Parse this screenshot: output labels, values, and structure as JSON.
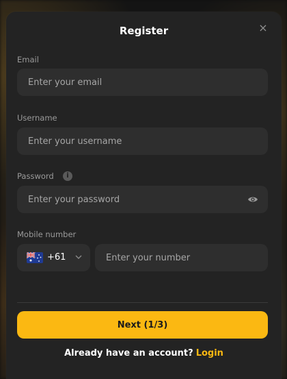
{
  "modal": {
    "title": "Register",
    "close_symbol": "×"
  },
  "email": {
    "label": "Email",
    "placeholder": "Enter your email"
  },
  "username": {
    "label": "Username",
    "placeholder": "Enter your username"
  },
  "password": {
    "label": "Password",
    "placeholder": "Enter your password",
    "info_symbol": "i"
  },
  "mobile": {
    "label": "Mobile number",
    "dial_code": "+61",
    "placeholder": "Enter your number"
  },
  "footer": {
    "next_label": "Next (1/3)",
    "prompt": "Already have an account?",
    "login_label": "Login"
  },
  "colors": {
    "accent": "#fbb812",
    "modal_bg": "#232323",
    "field_bg": "#2e2e2e"
  },
  "icons": {
    "close": "close-icon",
    "info": "info-icon",
    "eye": "eye-icon",
    "flag": "australia-flag-icon",
    "chevron": "chevron-down-icon"
  }
}
